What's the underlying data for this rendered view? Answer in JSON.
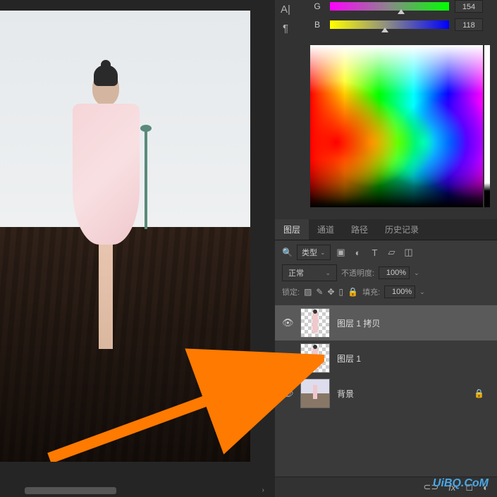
{
  "color": {
    "g_label": "G",
    "g_value": "154",
    "g_thumb_pct": 60,
    "b_label": "B",
    "b_value": "118",
    "b_thumb_pct": 46
  },
  "panel_tabs": {
    "layers": "图层",
    "channels": "通道",
    "paths": "路径",
    "history": "历史记录"
  },
  "layer_controls": {
    "filter_label": "类型",
    "blend_mode": "正常",
    "opacity_label": "不透明度:",
    "opacity_value": "100%",
    "lock_label": "锁定:",
    "fill_label": "填充:",
    "fill_value": "100%"
  },
  "layers": [
    {
      "name": "图层 1 拷贝",
      "visible": true,
      "selected": true,
      "locked": false,
      "thumb": "figure"
    },
    {
      "name": "图层 1",
      "visible": true,
      "selected": false,
      "locked": false,
      "thumb": "figure"
    },
    {
      "name": "背景",
      "visible": true,
      "selected": false,
      "locked": true,
      "thumb": "background"
    }
  ],
  "watermark": "UiBQ.CoM"
}
